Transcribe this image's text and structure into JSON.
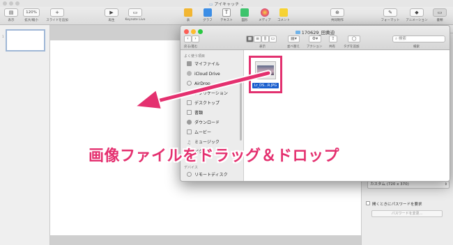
{
  "keynote": {
    "title": "アイキャッチ",
    "toolbar": {
      "view": "表示",
      "zoom_value": "120%",
      "zoom": "拡大/縮小",
      "add_slide": "スライドを追加",
      "play": "再生",
      "keynote_live": "Keynote Live",
      "table": "表",
      "chart": "グラフ",
      "text": "テキスト",
      "shape": "図形",
      "media": "メディア",
      "comment": "コメント",
      "collaborate": "共同制作",
      "format": "フォーマット",
      "animate": "アニメーション",
      "document": "書類"
    },
    "slide_number": "1",
    "inspector": {
      "slide_size": "カスタム (720 x 370)",
      "require_password": "開くときにパスワードを要求",
      "change_password": "パスワードを変更..."
    }
  },
  "finder": {
    "title": "170629_田黄迫",
    "toolbar": {
      "back_forward": "戻る/進む",
      "view": "表示",
      "arrange": "並べ替え",
      "action": "アクション",
      "share": "共有",
      "tags": "タグを追加",
      "search_placeholder": "検索",
      "search": "検索"
    },
    "sidebar": {
      "favorites_header": "よく使う項目",
      "favorites": [
        "マイファイル",
        "iCloud Drive",
        "AirDrop",
        "アプリケーション",
        "デスクトップ",
        "書類",
        "ダウンロード",
        "ムービー",
        "ミュージック",
        "ピクチャ"
      ],
      "devices_header": "デバイス",
      "devices": [
        "リモートディスク"
      ]
    },
    "file": {
      "name": "Lr_DS...R.JPG"
    }
  },
  "caption": "画像ファイルをドラッグ＆ドロップ",
  "colors": {
    "highlight": "#e4306f",
    "selection": "#1b5fce"
  }
}
